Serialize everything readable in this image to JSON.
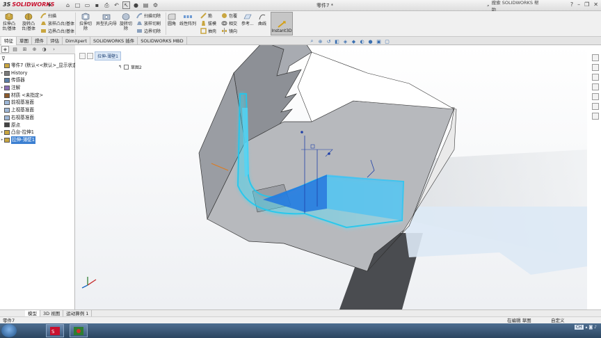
{
  "app": {
    "logo_text": "SOLIDWORKS",
    "document_title": "零件7 *",
    "search_placeholder": "搜索 SOLIDWORKS 帮助"
  },
  "ribbon": {
    "extrude_boss": "拉伸凸\n台/基体",
    "revolve_boss": "旋转凸\n台/基体",
    "sweep": "扫描",
    "loft": "放样凸台/基体",
    "boundary_boss": "边界凸台/基体",
    "extrude_cut": "拉伸切\n除",
    "hole_wizard": "异型孔向导",
    "revolve_cut": "旋转切\n除",
    "swept_cut": "扫描切除",
    "lofted_cut": "放样切割",
    "boundary_cut": "边界切除",
    "fillet": "圆角",
    "linear_pattern": "线性阵列",
    "rib": "筋",
    "draft": "拔模",
    "shell": "抽壳",
    "wrap": "包覆",
    "intersect": "相交",
    "mirror": "镜向",
    "reference_geometry": "参考...",
    "curves": "曲线",
    "instant3d": "Instant3D"
  },
  "command_tabs": [
    "特征",
    "草图",
    "焊件",
    "评估",
    "DimXpert",
    "SOLIDWORKS 插件",
    "SOLIDWORKS MBD"
  ],
  "feature_tree": {
    "filter_icon": "funnel-icon",
    "items": [
      {
        "label": "零件7 (默认<<默认>_显示状态",
        "arrow": "",
        "icon": "part-icon"
      },
      {
        "label": "History",
        "arrow": "▸",
        "icon": "history-icon"
      },
      {
        "label": "传感器",
        "arrow": "",
        "icon": "sensor-icon"
      },
      {
        "label": "注解",
        "arrow": "▸",
        "icon": "annotation-icon"
      },
      {
        "label": "材质 <未指定>",
        "arrow": "",
        "icon": "material-icon"
      },
      {
        "label": "前视基准面",
        "arrow": "",
        "icon": "plane-icon"
      },
      {
        "label": "上视基准面",
        "arrow": "",
        "icon": "plane-icon"
      },
      {
        "label": "右视基准面",
        "arrow": "",
        "icon": "plane-icon"
      },
      {
        "label": "原点",
        "arrow": "",
        "icon": "origin-icon"
      },
      {
        "label": "凸台-拉伸1",
        "arrow": "▸",
        "icon": "extrude-icon"
      },
      {
        "label": "拉伸-薄壁1",
        "arrow": "▸",
        "icon": "extrude-thin-icon",
        "selected": true
      }
    ]
  },
  "viewport": {
    "breadcrumb_feature": "拉伸-薄壁1",
    "context_label": "草图2"
  },
  "bottom_tabs": [
    "模型",
    "3D 视图",
    "运动算例 1"
  ],
  "status": {
    "left": "零件7",
    "editing": "在编辑 草图",
    "custom": "自定义"
  },
  "taskbar": {
    "lang": "CH"
  }
}
